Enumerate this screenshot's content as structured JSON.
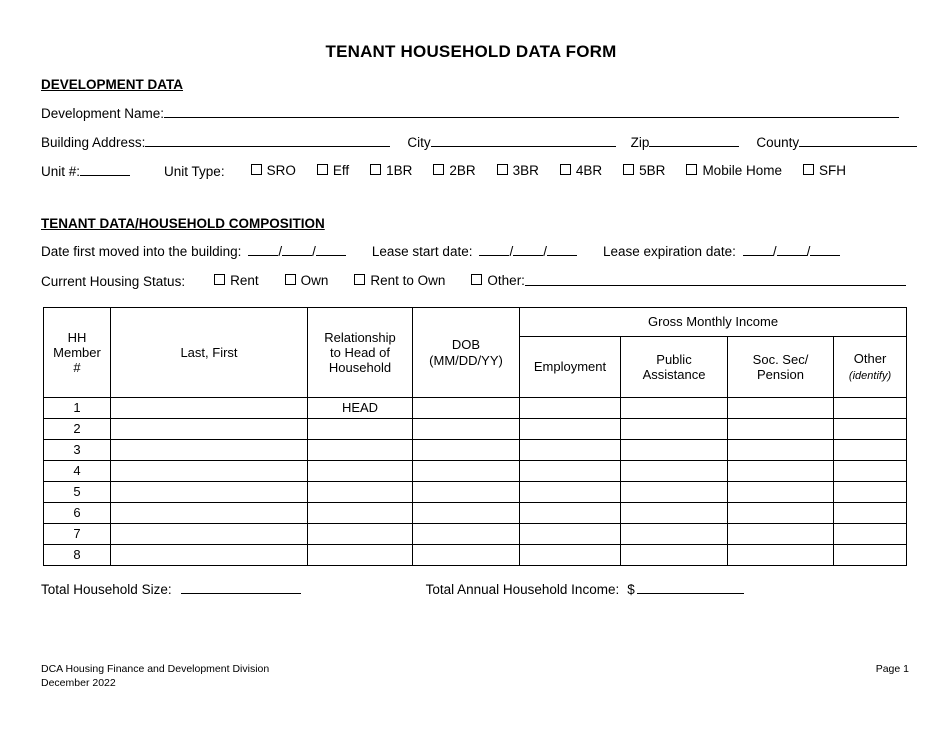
{
  "title": "TENANT HOUSEHOLD DATA FORM",
  "sections": {
    "development": {
      "heading": "DEVELOPMENT DATA",
      "development_name_label": "Development Name:",
      "building_address_label": "Building Address:",
      "city_label": "City",
      "zip_label": "Zip",
      "county_label": "County",
      "unit_number_label": "Unit #:",
      "unit_type_label": "Unit Type:",
      "unit_types": [
        "SRO",
        "Eff",
        "1BR",
        "2BR",
        "3BR",
        "4BR",
        "5BR",
        "Mobile Home",
        "SFH"
      ]
    },
    "tenant": {
      "heading": "TENANT DATA/HOUSEHOLD COMPOSITION",
      "moved_in_label": "Date first moved into the building:",
      "lease_start_label": "Lease start date:",
      "lease_expiration_label": "Lease expiration date:",
      "date_separator": "/",
      "housing_status_label": "Current Housing Status:",
      "housing_status_options": [
        "Rent",
        "Own",
        "Rent to Own"
      ],
      "other_label": "Other:"
    }
  },
  "table": {
    "group_header": "Gross Monthly Income",
    "columns": [
      "HH\nMember\n#",
      "Last, First",
      "Relationship\nto Head of\nHousehold",
      "DOB\n(MM/DD/YY)",
      "Employment",
      "Public\nAssistance",
      "Soc. Sec/\nPension",
      "Other"
    ],
    "other_sub_label": "(identify)",
    "rows": [
      {
        "member": "1",
        "name": "",
        "relationship": "HEAD",
        "dob": "",
        "employment": "",
        "public_assistance": "",
        "soc_sec_pension": "",
        "other": ""
      },
      {
        "member": "2",
        "name": "",
        "relationship": "",
        "dob": "",
        "employment": "",
        "public_assistance": "",
        "soc_sec_pension": "",
        "other": ""
      },
      {
        "member": "3",
        "name": "",
        "relationship": "",
        "dob": "",
        "employment": "",
        "public_assistance": "",
        "soc_sec_pension": "",
        "other": ""
      },
      {
        "member": "4",
        "name": "",
        "relationship": "",
        "dob": "",
        "employment": "",
        "public_assistance": "",
        "soc_sec_pension": "",
        "other": ""
      },
      {
        "member": "5",
        "name": "",
        "relationship": "",
        "dob": "",
        "employment": "",
        "public_assistance": "",
        "soc_sec_pension": "",
        "other": ""
      },
      {
        "member": "6",
        "name": "",
        "relationship": "",
        "dob": "",
        "employment": "",
        "public_assistance": "",
        "soc_sec_pension": "",
        "other": ""
      },
      {
        "member": "7",
        "name": "",
        "relationship": "",
        "dob": "",
        "employment": "",
        "public_assistance": "",
        "soc_sec_pension": "",
        "other": ""
      },
      {
        "member": "8",
        "name": "",
        "relationship": "",
        "dob": "",
        "employment": "",
        "public_assistance": "",
        "soc_sec_pension": "",
        "other": ""
      }
    ]
  },
  "totals": {
    "household_size_label": "Total Household Size:",
    "annual_income_label": "Total Annual Household Income:",
    "currency_symbol": "$"
  },
  "footer": {
    "line1": "DCA Housing Finance and Development Division",
    "line2": "December 2022",
    "page": "Page 1"
  },
  "colors": {
    "text": "#000000",
    "background": "#ffffff",
    "rule": "#000000"
  }
}
